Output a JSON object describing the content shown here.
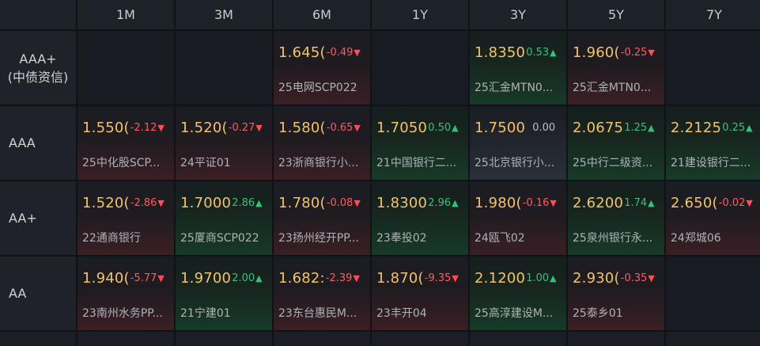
{
  "headers": [
    "1M",
    "3M",
    "6M",
    "1Y",
    "3Y",
    "5Y",
    "7Y"
  ],
  "rows": [
    {
      "label_lines": [
        "AAA+",
        "(中债资信)"
      ],
      "cells": [
        null,
        null,
        {
          "yield": "1.645(",
          "change": "-0.49",
          "direction": "down",
          "bond": "25电网SCP022"
        },
        null,
        {
          "yield": "1.8350",
          "change": "0.53",
          "direction": "up",
          "bond": "25汇金MTN0..."
        },
        {
          "yield": "1.960(",
          "change": "-0.25",
          "direction": "down",
          "bond": "25汇金MTN0..."
        },
        null
      ]
    },
    {
      "label_lines": [
        "AAA"
      ],
      "cells": [
        {
          "yield": "1.550(",
          "change": "-2.12",
          "direction": "down",
          "bond": "25中化股SCP..."
        },
        {
          "yield": "1.520(",
          "change": "-0.27",
          "direction": "down",
          "bond": "24平证01"
        },
        {
          "yield": "1.580(",
          "change": "-0.65",
          "direction": "down",
          "bond": "23浙商银行小..."
        },
        {
          "yield": "1.7050",
          "change": "0.50",
          "direction": "up",
          "bond": "21中国银行二..."
        },
        {
          "yield": "1.7500",
          "change": "0.00",
          "direction": "flat",
          "bond": "25北京银行小..."
        },
        {
          "yield": "2.0675",
          "change": "1.25",
          "direction": "up",
          "bond": "25中行二级资..."
        },
        {
          "yield": "2.2125",
          "change": "0.25",
          "direction": "up",
          "bond": "21建设银行二..."
        }
      ]
    },
    {
      "label_lines": [
        "AA+"
      ],
      "cells": [
        {
          "yield": "1.520(",
          "change": "-2.86",
          "direction": "down",
          "bond": "22通商银行"
        },
        {
          "yield": "1.7000",
          "change": "2.86",
          "direction": "up",
          "bond": "25厦商SCP022"
        },
        {
          "yield": "1.780(",
          "change": "-0.08",
          "direction": "down",
          "bond": "23扬州经开PP..."
        },
        {
          "yield": "1.8300",
          "change": "2.96",
          "direction": "up",
          "bond": "23奉投02"
        },
        {
          "yield": "1.980(",
          "change": "-0.16",
          "direction": "down",
          "bond": "24瓯飞02"
        },
        {
          "yield": "2.6200",
          "change": "1.74",
          "direction": "up",
          "bond": "25泉州银行永..."
        },
        {
          "yield": "2.650(",
          "change": "-0.02",
          "direction": "down",
          "bond": "24郑城06"
        }
      ]
    },
    {
      "label_lines": [
        "AA"
      ],
      "cells": [
        {
          "yield": "1.940(",
          "change": "-5.77",
          "direction": "down",
          "bond": "23南州水务PP..."
        },
        {
          "yield": "1.9700",
          "change": "2.00",
          "direction": "up",
          "bond": "21宁建01"
        },
        {
          "yield": "1.682:",
          "change": "-2.39",
          "direction": "down",
          "bond": "23东台惠民M..."
        },
        {
          "yield": "1.870(",
          "change": "-9.35",
          "direction": "down",
          "bond": "23丰开04"
        },
        {
          "yield": "2.1200",
          "change": "1.00",
          "direction": "up",
          "bond": "25高淳建设M..."
        },
        {
          "yield": "2.930(",
          "change": "-0.35",
          "direction": "down",
          "bond": "25泰乡01"
        },
        null
      ]
    }
  ]
}
